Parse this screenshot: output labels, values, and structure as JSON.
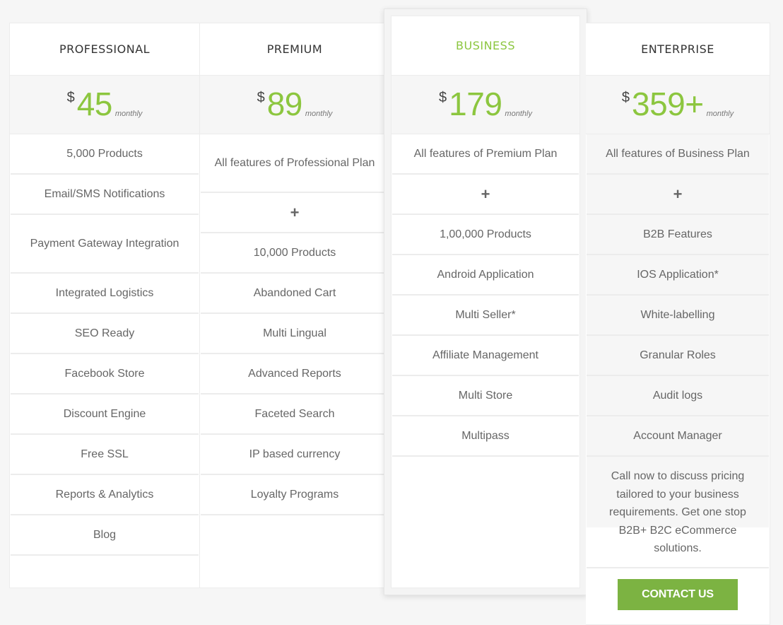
{
  "accent_color": "#8cc63f",
  "button_color": "#7cb342",
  "plans": [
    {
      "name": "PROFESSIONAL",
      "currency": "$",
      "price": "45",
      "period": "monthly",
      "features": [
        "5,000 Products",
        "Email/SMS Notifications",
        "Payment Gateway Integration",
        "Integrated Logistics",
        "SEO Ready",
        "Facebook Store",
        "Discount Engine",
        "Free SSL",
        "Reports & Analytics",
        "Blog"
      ]
    },
    {
      "name": "PREMIUM",
      "currency": "$",
      "price": "89",
      "period": "monthly",
      "features": [
        "All features of Professional Plan",
        "+",
        "10,000 Products",
        "Abandoned Cart",
        "Multi Lingual",
        "Advanced Reports",
        "Faceted Search",
        "IP based currency",
        "Loyalty Programs"
      ]
    },
    {
      "name": "BUSINESS",
      "highlighted": true,
      "currency": "$",
      "price": "179",
      "period": "monthly",
      "features": [
        "All features of Premium Plan",
        "+",
        "1,00,000 Products",
        "Android Application",
        "Multi Seller*",
        "Affiliate Management",
        "Multi Store",
        "Multipass"
      ]
    },
    {
      "name": "ENTERPRISE",
      "currency": "$",
      "price": "359+",
      "period": "monthly",
      "features": [
        "All features of Business Plan",
        "+",
        "B2B Features",
        "IOS Application*",
        "White-labelling",
        "Granular Roles",
        "Audit logs",
        "Account Manager"
      ],
      "note": "Call now to discuss pricing tailored to your business requirements. Get one stop B2B+ B2C eCommerce solutions.",
      "cta_label": "CONTACT US"
    }
  ]
}
